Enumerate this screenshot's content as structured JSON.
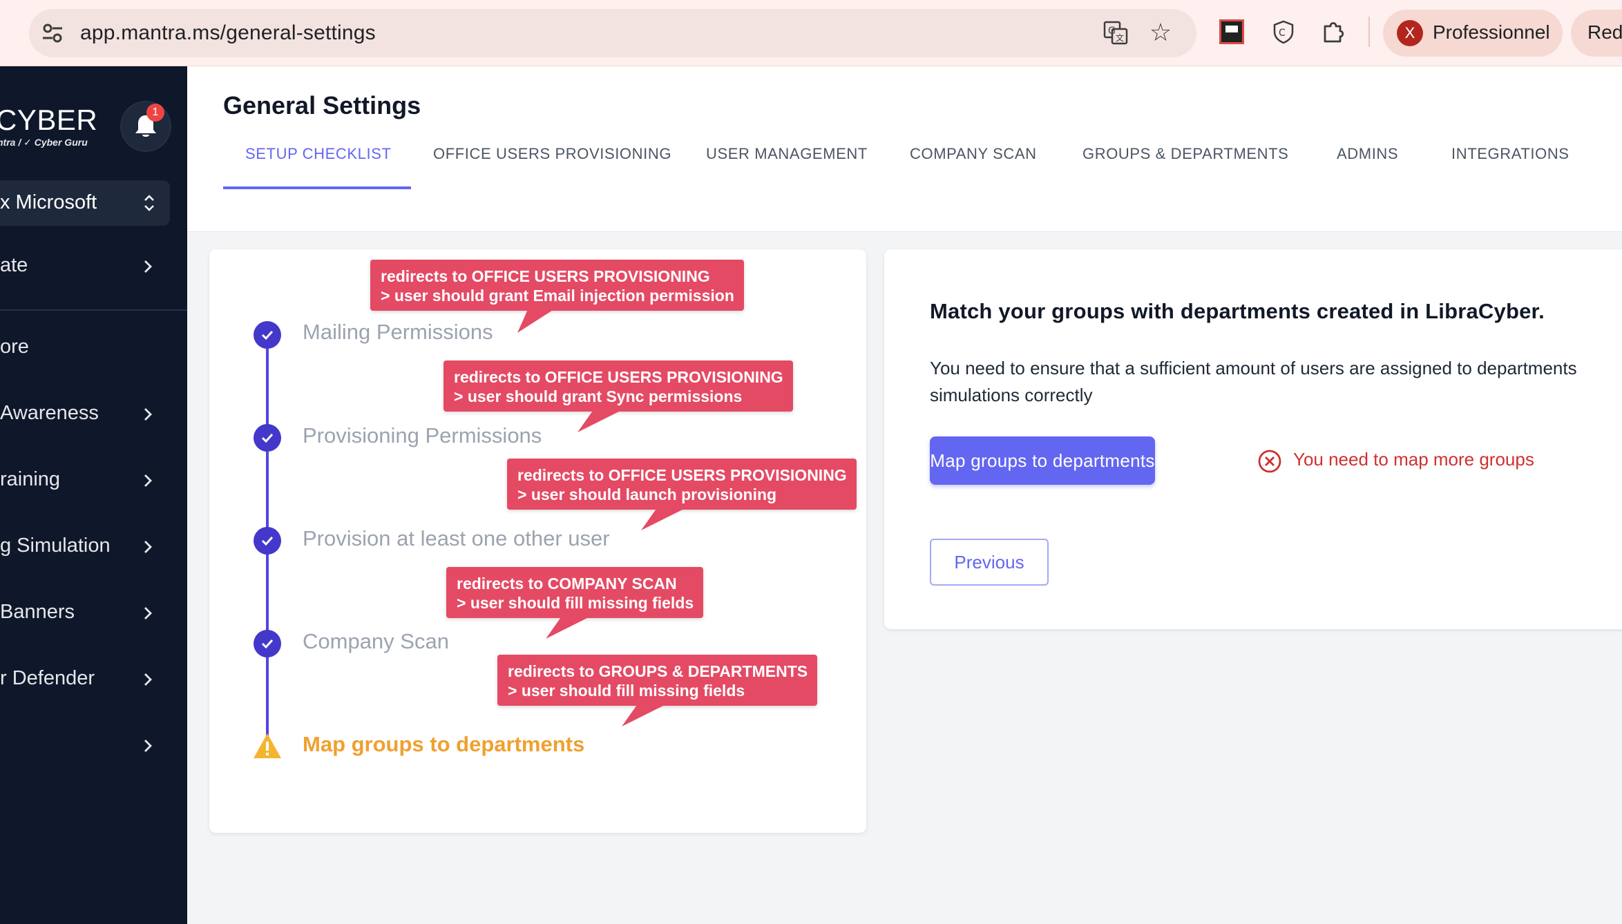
{
  "browser": {
    "url": "app.mantra.ms/general-settings",
    "profile_initial": "X",
    "profile_name": "Professionnel",
    "profile2_name": "Red"
  },
  "sidebar": {
    "brand": "CYBER",
    "brand_sub": "ntra / ✓ Cyber Guru",
    "notifications_count": "1",
    "tenant": "x Microsoft",
    "items": [
      {
        "label": "ate",
        "has_chevron": true
      },
      {
        "label": "ore",
        "has_chevron": false
      },
      {
        "label": "Awareness",
        "has_chevron": true
      },
      {
        "label": "raining",
        "has_chevron": true
      },
      {
        "label": "g Simulation",
        "has_chevron": true
      },
      {
        "label": "Banners",
        "has_chevron": true
      },
      {
        "label": "r Defender",
        "has_chevron": true
      },
      {
        "label": "",
        "has_chevron": true
      }
    ]
  },
  "header": {
    "title": "General Settings",
    "tabs": [
      {
        "label": "SETUP CHECKLIST",
        "active": true
      },
      {
        "label": "OFFICE USERS PROVISIONING",
        "active": false
      },
      {
        "label": "USER MANAGEMENT",
        "active": false
      },
      {
        "label": "COMPANY SCAN",
        "active": false
      },
      {
        "label": "GROUPS & DEPARTMENTS",
        "active": false
      },
      {
        "label": "ADMINS",
        "active": false
      },
      {
        "label": "INTEGRATIONS",
        "active": false
      }
    ]
  },
  "checklist": {
    "steps": [
      {
        "label": "Mailing Permissions",
        "status": "done"
      },
      {
        "label": "Provisioning Permissions",
        "status": "done"
      },
      {
        "label": "Provision at least one other user",
        "status": "done"
      },
      {
        "label": "Company Scan",
        "status": "done"
      },
      {
        "label": "Map groups to departments",
        "status": "warning"
      }
    ],
    "callouts": [
      {
        "line1": "redirects to OFFICE USERS PROVISIONING",
        "line2": "> user should grant Email injection permission"
      },
      {
        "line1": "redirects to OFFICE USERS PROVISIONING",
        "line2": "> user should grant Sync permissions"
      },
      {
        "line1": "redirects to OFFICE USERS PROVISIONING",
        "line2": "> user should launch provisioning"
      },
      {
        "line1": "redirects to COMPANY SCAN",
        "line2": "> user should fill missing fields"
      },
      {
        "line1": "redirects to GROUPS & DEPARTMENTS",
        "line2": "> user should fill missing fields"
      }
    ]
  },
  "detail": {
    "title": "Match your groups with departments created in LibraCyber.",
    "text_line1": "You need to ensure that a sufficient amount of users are assigned to departments",
    "text_line2": "simulations correctly",
    "primary_button": "Map groups to departments",
    "error_text": "You need to map more groups",
    "previous_button": "Previous"
  },
  "colors": {
    "accent": "#6366f1",
    "sidebar_bg": "#0f172a",
    "callout": "#e44a64",
    "warning": "#f0a030",
    "error": "#d03030"
  }
}
